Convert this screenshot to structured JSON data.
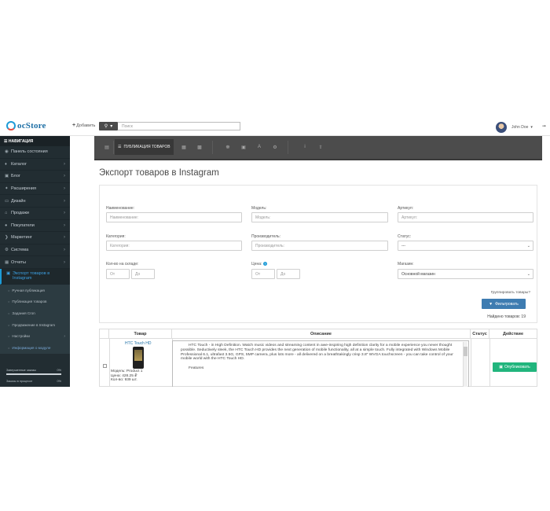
{
  "header": {
    "logo_text": "ocStore",
    "add_label": "Добавить",
    "search_placeholder": "Поиск",
    "user_name": "John Doe"
  },
  "sidebar": {
    "title": "НАВИГАЦИЯ",
    "items": [
      {
        "label": "Панель состояния",
        "icon": "dashboard-icon"
      },
      {
        "label": "Каталог",
        "icon": "tag-icon"
      },
      {
        "label": "Блог",
        "icon": "book-icon"
      },
      {
        "label": "Расширения",
        "icon": "puzzle-icon"
      },
      {
        "label": "Дизайн",
        "icon": "monitor-icon"
      },
      {
        "label": "Продажи",
        "icon": "cart-icon"
      },
      {
        "label": "Покупатели",
        "icon": "user-icon"
      },
      {
        "label": "Маркетинг",
        "icon": "share-icon"
      },
      {
        "label": "Система",
        "icon": "gear-icon"
      },
      {
        "label": "Отчеты",
        "icon": "bar-chart-icon"
      }
    ],
    "active_item": "Экспорт товаров в Instagram",
    "sub_items": [
      "Ручная публикация",
      "Публикация товаров",
      "Задания Cron",
      "Продвижение в Instagram",
      "Настройки",
      "Информация о модуле"
    ],
    "stats": [
      {
        "label": "Завершенные заказы",
        "value": "0%"
      },
      {
        "label": "Заказы в процессе",
        "value": "0%"
      }
    ]
  },
  "toolbar": {
    "active_label": "ПУБЛИКАЦИЯ ТОВАРОВ"
  },
  "page": {
    "title": "Экспорт товаров в Instagram"
  },
  "filters": {
    "name_label": "Наименование:",
    "name_placeholder": "Наименование:",
    "model_label": "Модель:",
    "model_placeholder": "Модель:",
    "sku_label": "Артикул:",
    "sku_placeholder": "Артикул:",
    "category_label": "Категория:",
    "category_placeholder": "Категория:",
    "manufacturer_label": "Производитель:",
    "manufacturer_placeholder": "Производитель:",
    "status_label": "Статус:",
    "status_value": "---",
    "quantity_label": "Кол-во на складе:",
    "from_placeholder": "От",
    "to_placeholder": "До",
    "price_label": "Цена:",
    "store_label": "Магазин:",
    "store_value": "Основной магазин",
    "group_question": "Группировать товары?",
    "filter_button": "Фильтровать",
    "found_text": "Найдено товаров: 19"
  },
  "table": {
    "columns": [
      "Товар",
      "Описание",
      "Статус",
      "Действие"
    ],
    "row": {
      "product_name": "HTC Touch HD",
      "model": "Модель: Product 1",
      "price": "Цена: 428.25 ₽",
      "quantity": "Кол-во: 939 шт.",
      "description_1": "HTC Touch - in High Definition. Watch music videos and streaming content in awe-inspiring high definition clarity for a mobile experience you never thought possible. Seductively sleek, the HTC Touch HD provides the next generation of mobile functionality, all at a simple touch. Fully integrated with Windows Mobile Professional 6.1, ultrafast 3.5G, GPS, 5MP camera, plus lots more - all delivered on a breathtakingly crisp 3.8\" WVGA touchscreen - you can take control of your mobile world with the HTC Touch HD.",
      "description_2": "Features",
      "publish_button": "Опубликовать"
    }
  },
  "colors": {
    "sidebar_bg": "#222d32",
    "accent": "#1d9bd7",
    "filter_button": "#3e7cb1",
    "publish_button": "#21b57d",
    "toolbar_bg": "#4c4c4c"
  }
}
